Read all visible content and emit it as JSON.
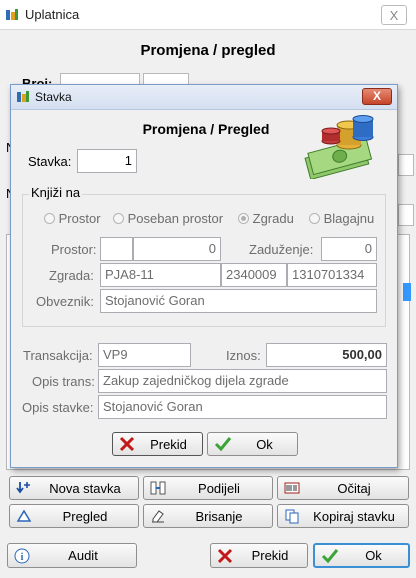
{
  "outer_window": {
    "title": "Uplatnica",
    "close": "X",
    "heading": "Promjena / pregled",
    "partial_label": "Broj:",
    "buttons": {
      "nova_stavka": "Nova stavka",
      "podijeli": "Podijeli",
      "ocitaj": "Očitaj",
      "pregled": "Pregled",
      "brisanje": "Brisanje",
      "kopiraj_stavku": "Kopiraj stavku",
      "audit": "Audit",
      "prekid": "Prekid",
      "ok": "Ok"
    }
  },
  "dialog": {
    "title": "Stavka",
    "close": "X",
    "heading": "Promjena / Pregled",
    "stavka_label": "Stavka:",
    "stavka_value": "1",
    "knjizi_label": "Knjiži na",
    "radios": [
      {
        "label": "Prostor",
        "checked": false
      },
      {
        "label": "Poseban prostor",
        "checked": false
      },
      {
        "label": "Zgradu",
        "checked": true
      },
      {
        "label": "Blagajnu",
        "checked": false
      }
    ],
    "prostor_label": "Prostor:",
    "prostor_code": "",
    "prostor_value": "0",
    "zaduzenje_label": "Zaduženje:",
    "zaduzenje_value": "0",
    "zgrada_label": "Zgrada:",
    "zgrada_code": "PJA8-11",
    "zgrada_num1": "2340009",
    "zgrada_num2": "1310701334",
    "obveznik_label": "Obveznik:",
    "obveznik_value": "Stojanović Goran",
    "transakcija_label": "Transakcija:",
    "transakcija_value": "VP9",
    "iznos_label": "Iznos:",
    "iznos_value": "500,00",
    "opis_trans_label": "Opis trans:",
    "opis_trans_value": "Zakup zajedničkog dijela zgrade",
    "opis_stavke_label": "Opis stavke:",
    "opis_stavke_value": "Stojanović Goran",
    "prekid_label": "Prekid",
    "ok_label": "Ok"
  }
}
